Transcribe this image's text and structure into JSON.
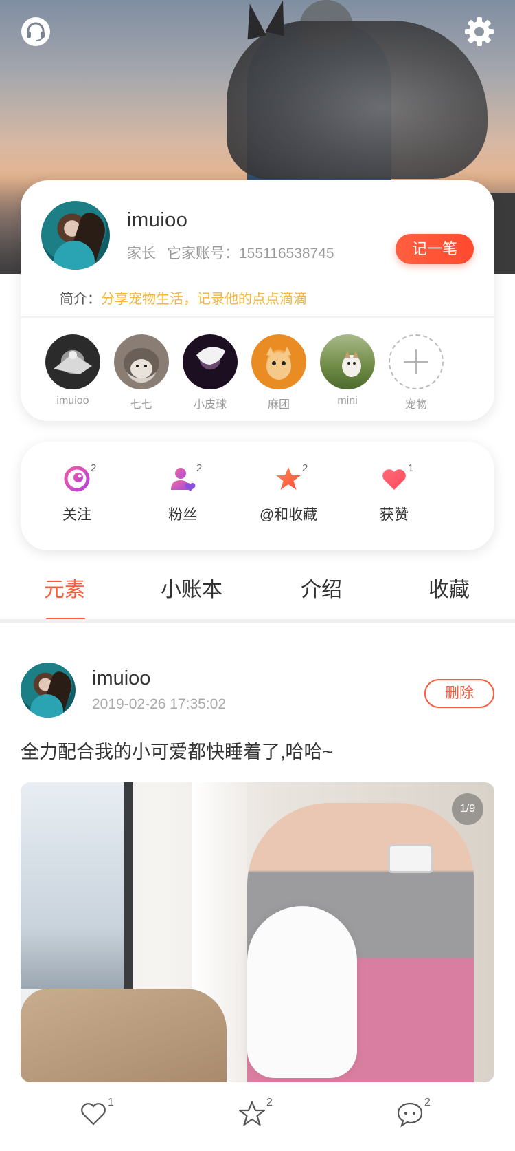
{
  "header": {
    "left_icon": "headset-icon",
    "right_icon": "gear-icon"
  },
  "profile": {
    "name": "imuioo",
    "role": "家长",
    "account_label": "它家账号：155116538745",
    "record_button": "记一笔",
    "bio_label": "简介：",
    "bio_text": "分享宠物生活，记录他的点点滴滴"
  },
  "pets": [
    {
      "name": "imuioo"
    },
    {
      "name": "七七"
    },
    {
      "name": "小皮球"
    },
    {
      "name": "麻团"
    },
    {
      "name": "mini"
    },
    {
      "name": "宠物",
      "icon": "plus-icon"
    }
  ],
  "stats": [
    {
      "label": "关注",
      "count": "2",
      "icon": "eye-icon"
    },
    {
      "label": "粉丝",
      "count": "2",
      "icon": "user-heart-icon"
    },
    {
      "label": "@和收藏",
      "count": "2",
      "icon": "star-icon"
    },
    {
      "label": "获赞",
      "count": "1",
      "icon": "heart-icon"
    }
  ],
  "tabs": [
    {
      "label": "元素",
      "active": true
    },
    {
      "label": "小账本",
      "active": false
    },
    {
      "label": "介绍",
      "active": false
    },
    {
      "label": "收藏",
      "active": false
    }
  ],
  "post": {
    "author": "imuioo",
    "time": "2019-02-26 17:35:02",
    "delete_label": "删除",
    "text": "全力配合我的小可爱都快睡着了,哈哈~",
    "image_counter": "1/9",
    "actions": [
      {
        "icon": "heart-outline-icon",
        "count": "1"
      },
      {
        "icon": "star-outline-icon",
        "count": "2"
      },
      {
        "icon": "comment-icon",
        "count": "2"
      }
    ]
  },
  "colors": {
    "accent": "#ff5a3c",
    "bio_highlight": "#f7b43a"
  }
}
